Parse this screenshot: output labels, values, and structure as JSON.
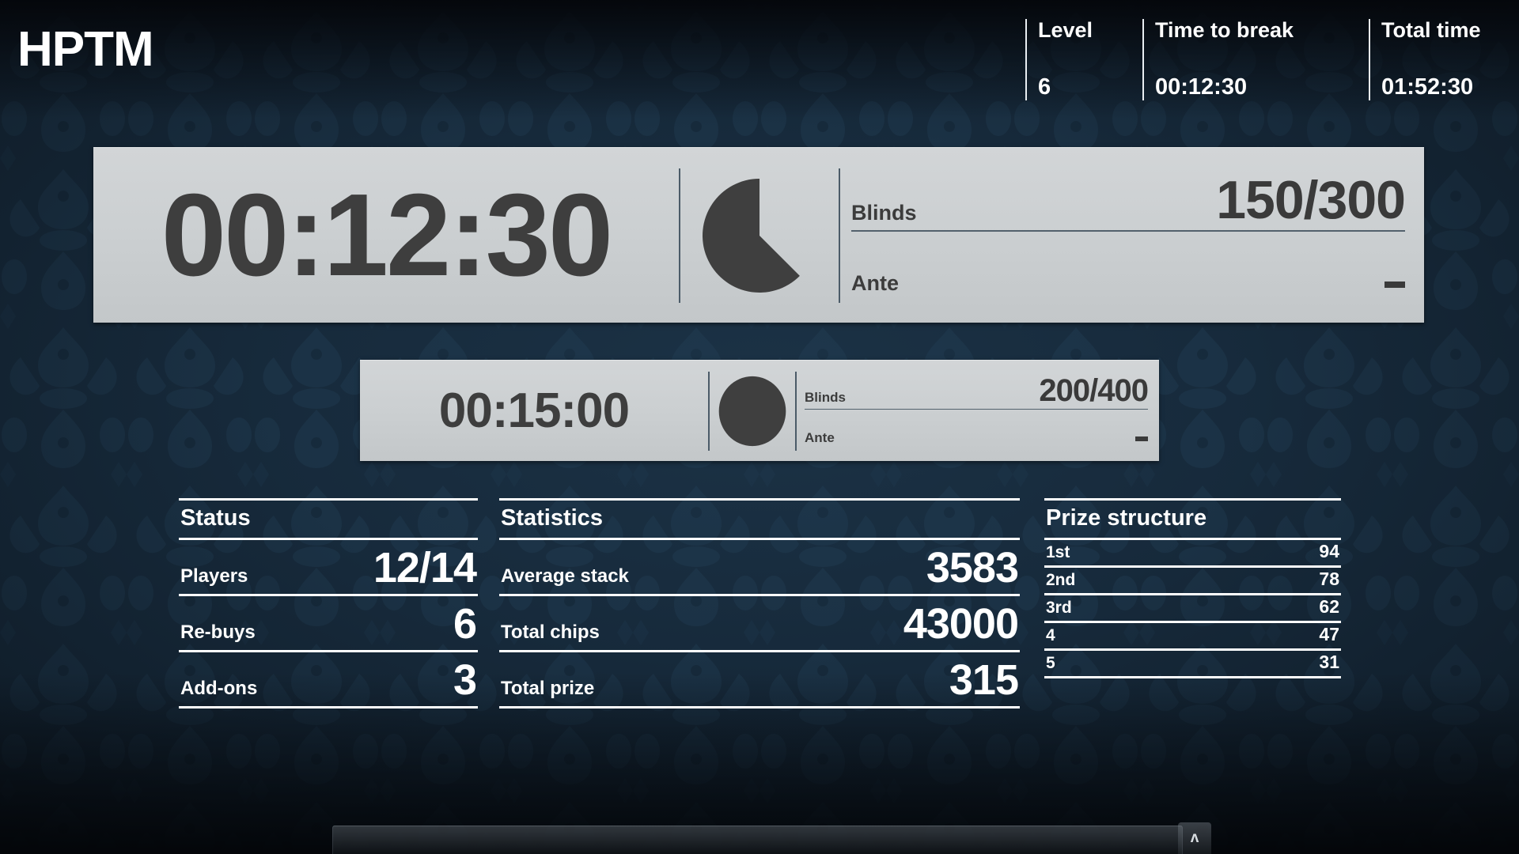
{
  "app": {
    "logo": "HPTM",
    "colors": {
      "background": "#16293a",
      "plate": "#cbcfd1",
      "plate_text": "#3e3e3e",
      "text": "#ffffff",
      "rule": "#53616d"
    }
  },
  "header": {
    "items": [
      {
        "label": "Level",
        "value": "6"
      },
      {
        "label": "Time to break",
        "value": "00:12:30"
      },
      {
        "label": "Total time",
        "value": "01:52:30"
      }
    ]
  },
  "current_level": {
    "clock": "00:12:30",
    "pie_icon": "pie-progress-icon",
    "pie_remaining_fraction": 0.625,
    "blinds_label": "Blinds",
    "blinds_value": "150/300",
    "ante_label": "Ante",
    "ante_value": "-"
  },
  "next_level": {
    "clock": "00:15:00",
    "pie_icon": "pie-full-icon",
    "pie_remaining_fraction": 1.0,
    "blinds_label": "Blinds",
    "blinds_value": "200/400",
    "ante_label": "Ante",
    "ante_value": "-"
  },
  "status_table": {
    "title": "Status",
    "rows": [
      {
        "key": "Players",
        "value": "12/14"
      },
      {
        "key": "Re-buys",
        "value": "6"
      },
      {
        "key": "Add-ons",
        "value": "3"
      }
    ]
  },
  "statistics_table": {
    "title": "Statistics",
    "rows": [
      {
        "key": "Average stack",
        "value": "3583"
      },
      {
        "key": "Total chips",
        "value": "43000"
      },
      {
        "key": "Total prize",
        "value": "315"
      }
    ]
  },
  "prize_table": {
    "title": "Prize structure",
    "rows": [
      {
        "key": "1st",
        "value": "94"
      },
      {
        "key": "2nd",
        "value": "78"
      },
      {
        "key": "3rd",
        "value": "62"
      },
      {
        "key": "4",
        "value": "47"
      },
      {
        "key": "5",
        "value": "31"
      }
    ]
  },
  "toolbar": {
    "expand_icon": "chevron-up-icon",
    "expand_glyph": "ʌ"
  }
}
